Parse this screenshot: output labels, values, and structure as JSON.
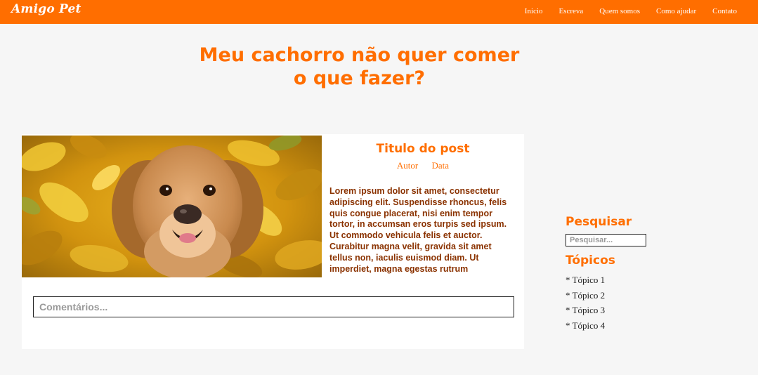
{
  "header": {
    "logo": "Amigo Pet",
    "nav": [
      "Inicio",
      "Escreva",
      "Quem somos",
      "Como ajudar",
      "Contato"
    ]
  },
  "page": {
    "headline_line1": "Meu cachorro não quer comer",
    "headline_line2": "o que fazer?"
  },
  "post": {
    "title": "Titulo do post",
    "author": "Autor",
    "date": "Data",
    "body": "Lorem ipsum dolor sit amet, consectetur adipiscing elit. Suspendisse rhoncus, felis quis congue placerat, nisi enim tempor tortor, in accumsan eros turpis sed ipsum. Ut commodo vehicula felis et auctor. Curabitur magna velit, gravida sit amet tellus non, iaculis euismod diam. Ut imperdiet, magna egestas rutrum",
    "comment_placeholder": "Comentários..."
  },
  "sidebar": {
    "search_heading": "Pesquisar",
    "search_placeholder": "Pesquisar...",
    "topics_heading": "Tópicos",
    "topics": [
      "* Tópico 1",
      "* Tópico 2",
      "* Tópico 3",
      "* Tópico 4"
    ]
  },
  "colors": {
    "brand": "#ff6e00",
    "body_text": "#8a3200",
    "background": "#f6f6f6"
  }
}
